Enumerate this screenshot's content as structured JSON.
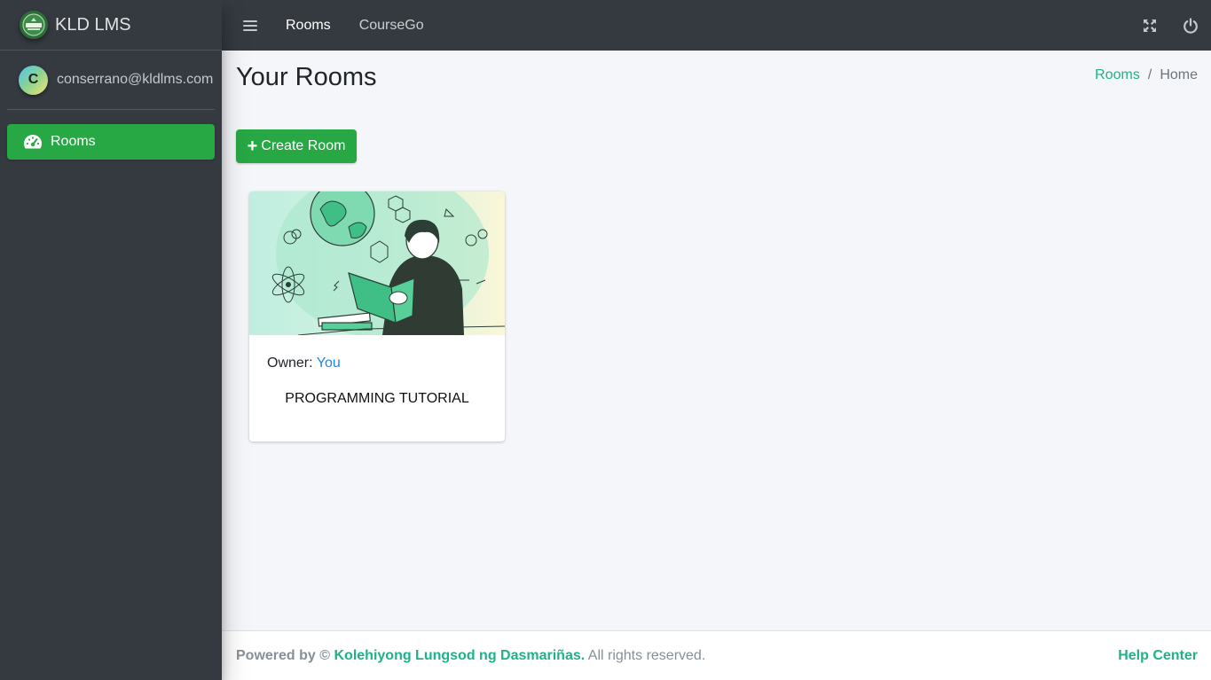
{
  "brand": {
    "name": "KLD LMS",
    "logo_icon": "coursego-logo-icon"
  },
  "user": {
    "initial": "C",
    "email": "conserrano@kldlms.com"
  },
  "sidebar": {
    "items": [
      {
        "label": "Rooms",
        "icon": "dashboard-gauge-icon",
        "active": true
      }
    ]
  },
  "topbar": {
    "menu_icon": "hamburger-icon",
    "links": [
      {
        "label": "Rooms",
        "active": true
      },
      {
        "label": "CourseGo",
        "active": false
      }
    ],
    "right_icons": [
      "expand-fullscreen-icon",
      "power-icon"
    ]
  },
  "page": {
    "title": "Your Rooms"
  },
  "breadcrumb": {
    "link": "Rooms",
    "separator": "/",
    "current": "Home"
  },
  "actions": {
    "create_room": "Create Room"
  },
  "rooms": [
    {
      "owner_label": "Owner:",
      "owner_value": "You",
      "title": "PROGRAMMING TUTORIAL"
    }
  ],
  "footer": {
    "powered": "Powered by ©",
    "institution": "Kolehiyong Lungsod ng Dasmariñas.",
    "rights": "All rights reserved.",
    "help": "Help Center"
  },
  "colors": {
    "sidebar_bg": "#343a40",
    "accent_green": "#28a745",
    "link_teal": "#20b18a",
    "owner_blue": "#1e88e5",
    "content_bg": "#f4f6f9"
  }
}
